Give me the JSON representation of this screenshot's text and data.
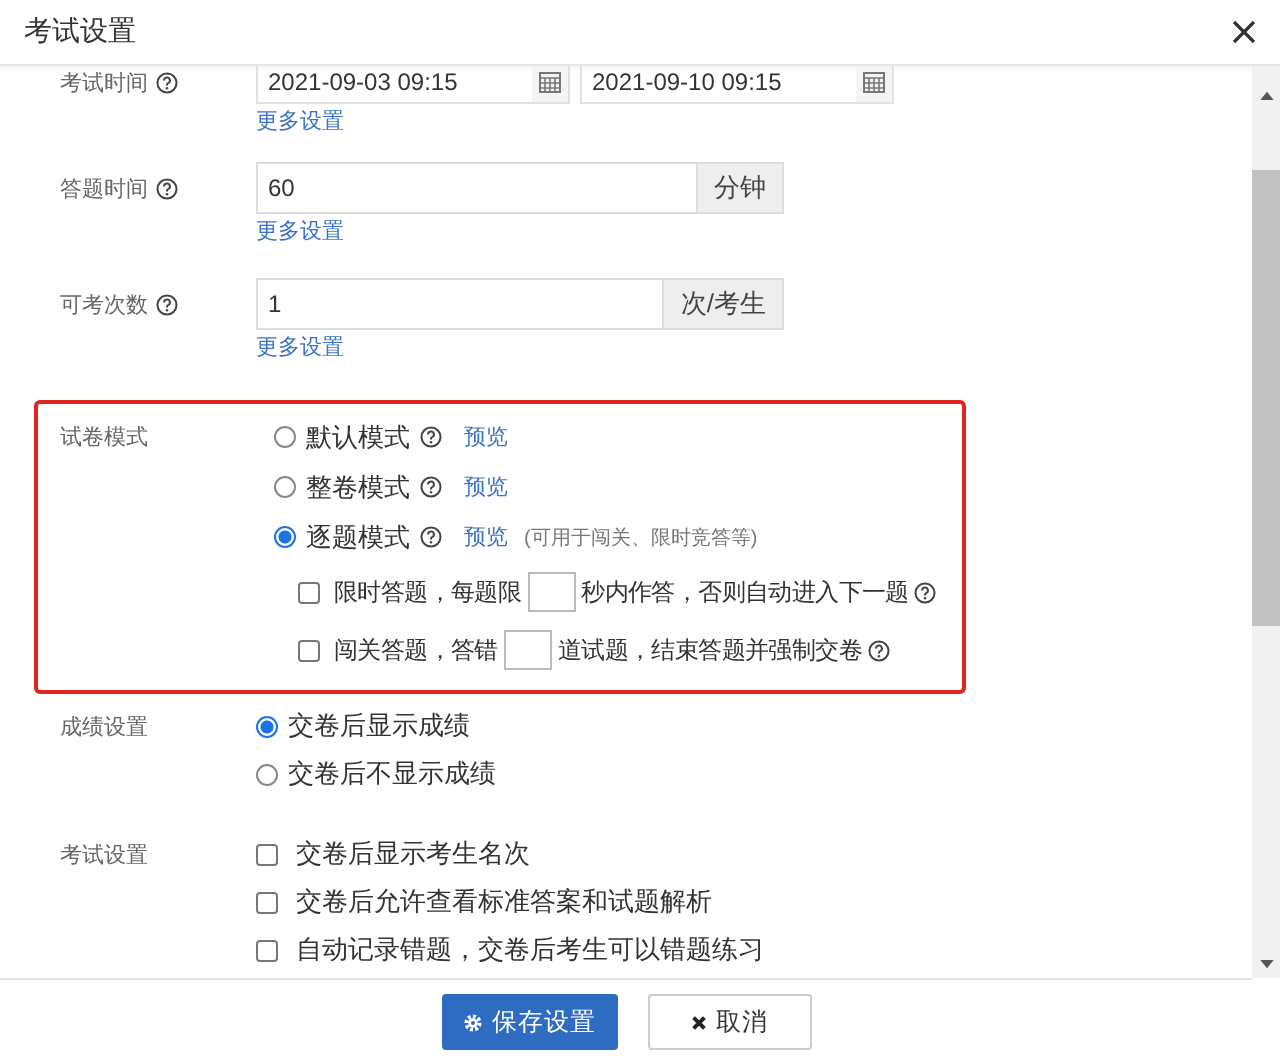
{
  "dialog": {
    "title": "考试设置"
  },
  "settings": [
    {
      "kind": "date_range",
      "label": "考试时间",
      "start": "2021-09-03 09:15",
      "end": "2021-09-10 09:15",
      "link": "更多设置"
    },
    {
      "kind": "input_addon",
      "label": "答题时间",
      "value": "60",
      "unit": "分钟",
      "link": "更多设置"
    },
    {
      "kind": "input_addon",
      "label": "可考次数",
      "value": "1",
      "unit": "次/考生",
      "link": "更多设置"
    },
    {
      "kind": "paper_mode",
      "label": "试卷模式",
      "highlighted": true,
      "options": [
        {
          "label": "默认模式",
          "selected": false,
          "link": "预览"
        },
        {
          "label": "整卷模式",
          "selected": false,
          "link": "预览"
        },
        {
          "label": "逐题模式",
          "selected": true,
          "link": "预览",
          "note": "(可用于闯关、限时竞答等)"
        }
      ],
      "sub_options": [
        {
          "before": "限时答题，每题限",
          "after": "秒内作答，否则自动进入下一题",
          "checked": false
        },
        {
          "before": "闯关答题，答错",
          "after": "道试题，结束答题并强制交卷",
          "checked": false
        }
      ]
    },
    {
      "kind": "radio_group",
      "label": "成绩设置",
      "options": [
        {
          "label": "交卷后显示成绩",
          "selected": true
        },
        {
          "label": "交卷后不显示成绩",
          "selected": false
        }
      ]
    },
    {
      "kind": "checkbox_group",
      "label": "考试设置",
      "options": [
        {
          "label": "交卷后显示考生名次",
          "checked": false
        },
        {
          "label": "交卷后允许查看标准答案和试题解析",
          "checked": false
        },
        {
          "label": "自动记录错题，交卷后考生可以错题练习",
          "checked": false
        }
      ]
    }
  ],
  "buttons": [
    {
      "label": "保存设置",
      "kind": "primary"
    },
    {
      "label": "取消",
      "kind": "default"
    }
  ]
}
